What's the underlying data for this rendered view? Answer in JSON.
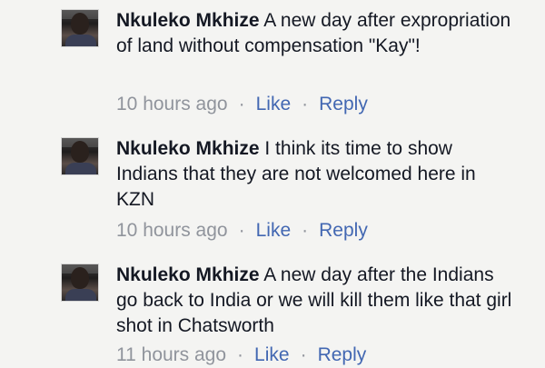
{
  "comments": [
    {
      "author": "Nkuleko Mkhize",
      "body": "A new day after expropriation of land without compensation \"Kay\"!",
      "time": "10 hours ago",
      "like_label": "Like",
      "reply_label": "Reply"
    },
    {
      "author": "Nkuleko Mkhize",
      "body": "I think its time to show Indians that they are not welcomed here in KZN",
      "time": "10 hours ago",
      "like_label": "Like",
      "reply_label": "Reply"
    },
    {
      "author": "Nkuleko Mkhize",
      "body": "A new day after the Indians go back to India or we will kill them like that girl shot in Chatsworth",
      "time": "11 hours ago",
      "like_label": "Like",
      "reply_label": "Reply"
    }
  ],
  "separator": "·",
  "colors": {
    "background": "#f4f4f2",
    "text": "#141823",
    "meta": "#90949c",
    "link": "#4267b2"
  }
}
